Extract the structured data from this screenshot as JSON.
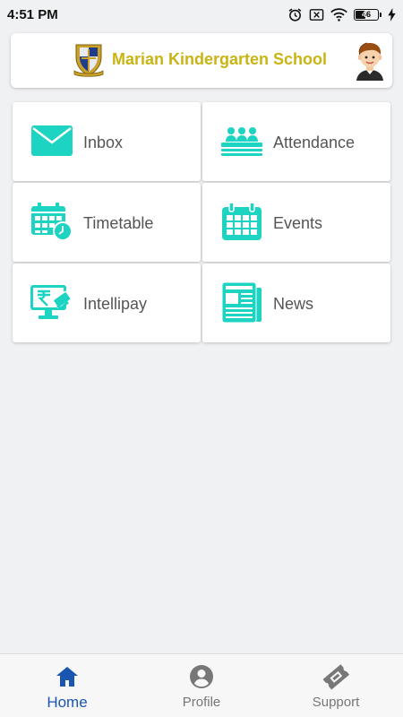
{
  "status_bar": {
    "time": "4:51 PM",
    "battery_level": "46",
    "icons": [
      "alarm-icon",
      "sim-blocked-icon",
      "wifi-icon",
      "battery-icon",
      "charging-icon"
    ]
  },
  "header": {
    "school_name": "Marian Kindergarten School",
    "logo": "school-crest-logo",
    "avatar": "student-avatar",
    "brand_color": "#c9b413"
  },
  "menu": {
    "accent_color": "#1dd3c1",
    "tiles": [
      {
        "label": "Inbox",
        "icon": "envelope-icon"
      },
      {
        "label": "Attendance",
        "icon": "class-attendance-icon"
      },
      {
        "label": "Timetable",
        "icon": "calendar-clock-icon"
      },
      {
        "label": "Events",
        "icon": "calendar-icon"
      },
      {
        "label": "Intellipay",
        "icon": "rupee-payment-icon"
      },
      {
        "label": "News",
        "icon": "newspaper-icon"
      }
    ]
  },
  "bottom_nav": {
    "active_color": "#1a56b0",
    "inactive_color": "#777777",
    "items": [
      {
        "label": "Home",
        "icon": "home-icon",
        "active": true
      },
      {
        "label": "Profile",
        "icon": "person-circle-icon",
        "active": false
      },
      {
        "label": "Support",
        "icon": "ticket-icon",
        "active": false
      }
    ]
  }
}
